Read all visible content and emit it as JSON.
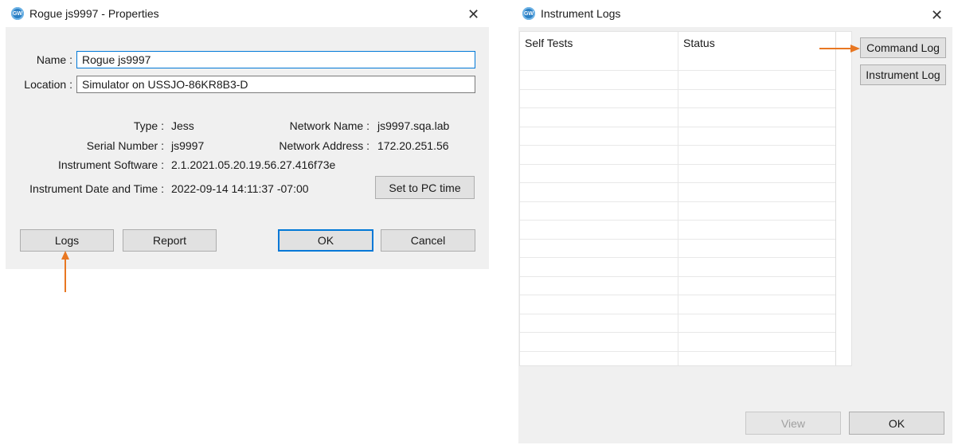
{
  "properties_dialog": {
    "title": "Rogue js9997 - Properties",
    "icon": "app-logo-icon",
    "close_glyph": "✕",
    "name_label": "Name :",
    "name_value": "Rogue js9997",
    "location_label": "Location :",
    "location_value": "Simulator on USSJO-86KR8B3-D",
    "type_label": "Type :",
    "type_value": "Jess",
    "serial_label": "Serial Number :",
    "serial_value": "js9997",
    "software_label": "Instrument Software :",
    "software_value": "2.1.2021.05.20.19.56.27.416f73e",
    "datetime_label": "Instrument Date and Time :",
    "datetime_value": "2022-09-14 14:11:37 -07:00",
    "network_name_label": "Network Name :",
    "network_name_value": "js9997.sqa.lab",
    "network_address_label": "Network Address :",
    "network_address_value": "172.20.251.56",
    "set_pc_time_button": "Set to PC time",
    "logs_button": "Logs",
    "report_button": "Report",
    "ok_button": "OK",
    "cancel_button": "Cancel"
  },
  "logs_dialog": {
    "title": "Instrument Logs",
    "icon": "app-logo-icon",
    "close_glyph": "✕",
    "columns": [
      "Self Tests",
      "Status"
    ],
    "command_log_button": "Command Log",
    "instrument_log_button": "Instrument Log",
    "view_button": "View",
    "ok_button": "OK"
  },
  "annotations": {
    "arrow_color": "#e87722"
  }
}
